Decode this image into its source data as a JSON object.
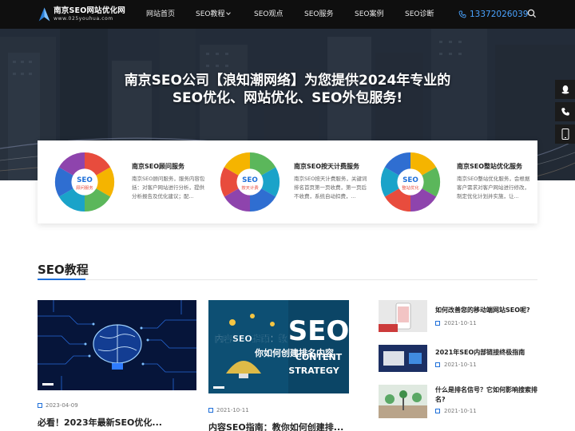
{
  "header": {
    "logo_title": "南京SEO网站优化网",
    "logo_sub": "www.025youhua.com",
    "nav": [
      {
        "label": "网站首页"
      },
      {
        "label": "SEO教程"
      },
      {
        "label": "SEO观点"
      },
      {
        "label": "SEO服务"
      },
      {
        "label": "SEO案例"
      },
      {
        "label": "SEO诊断"
      }
    ],
    "phone": "13372026039"
  },
  "hero": {
    "line1": "南京SEO公司【浪知潮网络】为您提供2024年专业的",
    "line2": "SEO优化、网站优化、SEO外包服务!"
  },
  "services": [
    {
      "title": "南京SEO顾问服务",
      "desc": "南京SEO顾问服务，服务内容包括：对客户网站进行分析，提供分析报告及优化建议；配...",
      "wheel_center": "SEO",
      "wheel_sub": "顾问服务"
    },
    {
      "title": "南京SEO按天计费服务",
      "desc": "南京SEO按天计费服务，关键词排名首页第一页收费，第一页后不收费，系统自动扣费，...",
      "wheel_center": "SEO",
      "wheel_sub": "按天计费"
    },
    {
      "title": "南京SEO整站优化服务",
      "desc": "南京SEO整站优化服务，会根据客户需求对客户网站进行修改，制定优化计划并实施，让...",
      "wheel_center": "SEO",
      "wheel_sub": "整站优化"
    }
  ],
  "tutorials": {
    "section_title": "SEO教程",
    "featured": [
      {
        "date": "2023-04-09",
        "title": "必看！2023年最新SEO优化..."
      },
      {
        "date": "2021-10-11",
        "title": "内容SEO指南：教你如何创建排...",
        "img_text1": "内容SEO指南：教",
        "img_text2": "你如何创建排名内容",
        "img_big": "SEO",
        "img_small1": "CONTENT",
        "img_small2": "STRATEGY"
      }
    ],
    "list": [
      {
        "title": "如何改善您的移动端网站SEO呢?",
        "date": "2021-10-11"
      },
      {
        "title": "2021年SEO内部链接终极指南",
        "date": "2021-10-11"
      },
      {
        "title": "什么是排名信号？它如何影响搜索排名?",
        "date": "2021-10-11"
      }
    ]
  },
  "colors": {
    "header_bg": "#0f0f0f",
    "accent": "#1e6fd9",
    "phone": "#4aa3ff"
  }
}
